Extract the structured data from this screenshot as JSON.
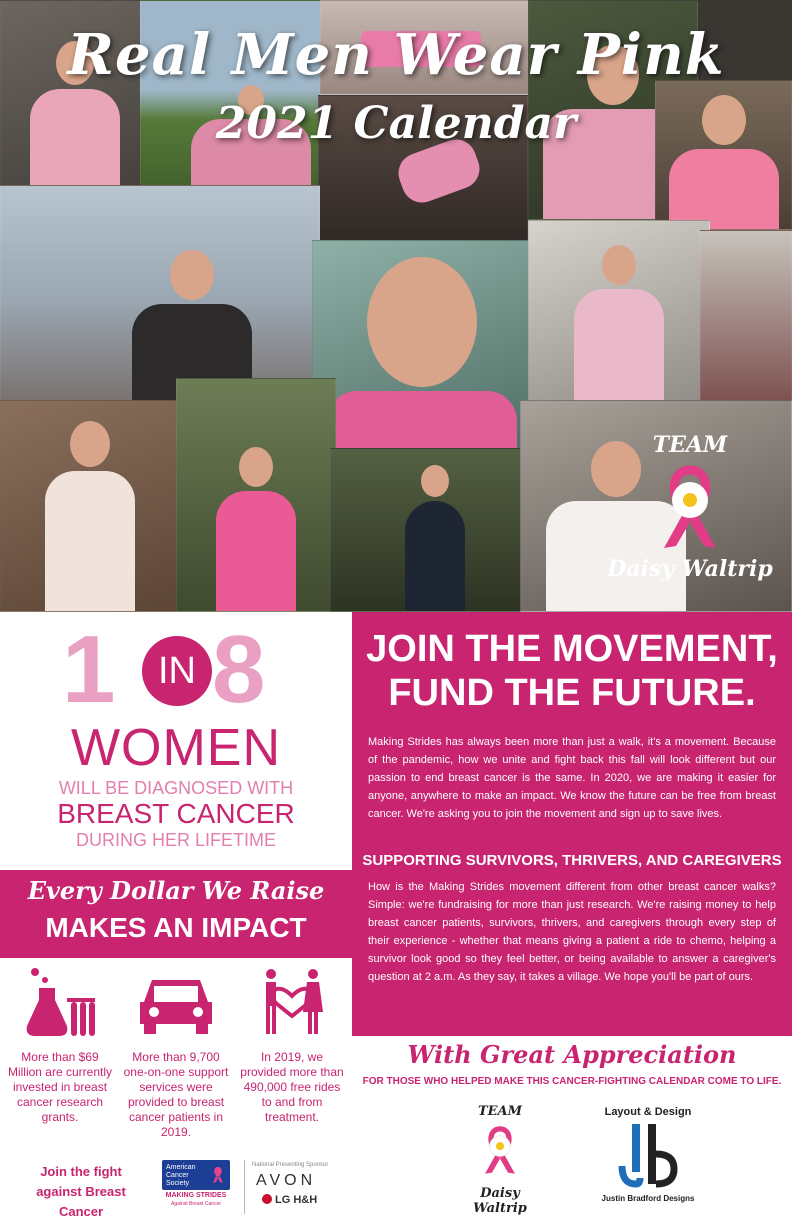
{
  "header": {
    "title_line1": "Real Men Wear Pink",
    "title_line2": "2021 Calendar"
  },
  "team_badge": {
    "team_word": "TEAM",
    "name": "Daisy Waltrip"
  },
  "stat": {
    "num1": "1",
    "in_word": "IN",
    "num2": "8",
    "women": "WOMEN",
    "line1": "WILL BE DIAGNOSED WITH",
    "line2": "BREAST CANCER",
    "line3": "DURING HER LIFETIME"
  },
  "impact": {
    "script": "Every Dollar We Raise",
    "headline": "MAKES AN IMPACT",
    "items": [
      {
        "icon": "lab-flask-icon",
        "text": "More than $69 Million are currently invested in breast cancer research grants."
      },
      {
        "icon": "car-icon",
        "text": "More than 9,700 one-on-one support services were provided to breast cancer patients in 2019."
      },
      {
        "icon": "people-heart-icon",
        "text": "In 2019, we provided more than 490,000 free rides to and from treatment."
      }
    ]
  },
  "footer_left": {
    "join_text": "Join the fight against Breast Cancer",
    "acs_name": "American Cancer Society",
    "making_strides": "MAKING STRIDES",
    "against": "Against Breast Cancer",
    "sponsor_label": "National Presenting Sponsor",
    "avon": "AVON",
    "lg": "LG H&H"
  },
  "movement": {
    "heading1": "JOIN THE MOVEMENT,",
    "heading2": "FUND THE FUTURE.",
    "paragraph1": "Making Strides has always been more than just a walk, it's a movement. Because of the pandemic, how we unite and fight back this fall will look different but our passion to end breast cancer is the same. In 2020, we are making it easier for anyone, anywhere to make an impact. We know the future can be free from breast cancer. We're asking you to join the movement and sign up to save lives.",
    "subheading": "SUPPORTING SURVIVORS, THRIVERS, AND CAREGIVERS",
    "paragraph2": "How is the Making Strides movement different from other breast cancer walks? Simple: we're fundraising for more than just research. We're raising money to help breast cancer patients, survivors, thrivers, and caregivers through every step of their experience - whether that means giving a patient a ride to chemo, helping a survivor look good so they feel better, or being available to answer a caregiver's question at 2 a.m. As they say, it takes a village. We hope you'll be part of ours."
  },
  "appreciation": {
    "heading": "With Great Appreciation",
    "sub": "FOR THOSE WHO HELPED MAKE THIS CANCER-FIGHTING CALENDAR COME TO LIFE.",
    "team_word": "TEAM",
    "team_name": "Daisy Waltrip",
    "layout_label": "Layout & Design",
    "designer_name": "Justin Bradford Designs"
  },
  "colors": {
    "brand_pink": "#c8246f",
    "light_pink": "#e9a0c2",
    "acs_blue": "#1c3f95"
  }
}
